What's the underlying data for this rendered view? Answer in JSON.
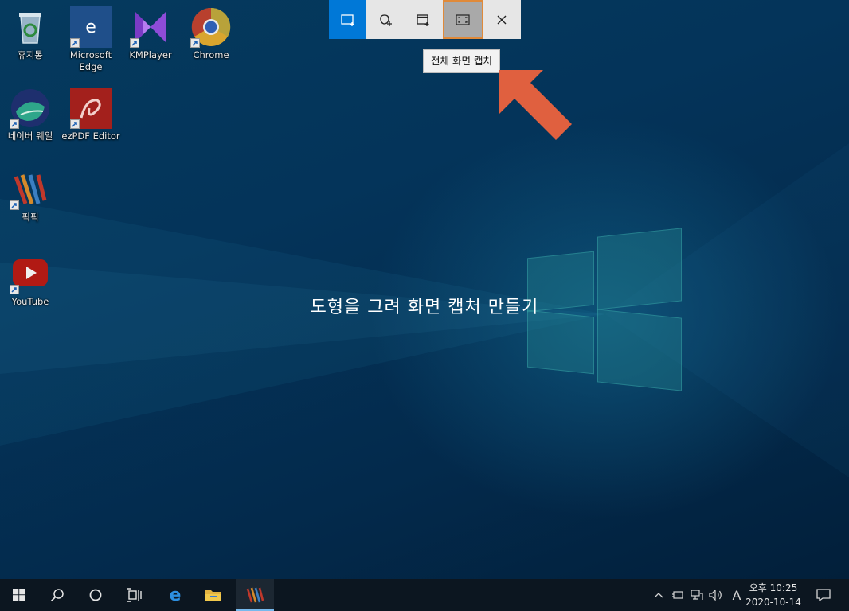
{
  "desktop": {
    "icons": [
      {
        "label": "휴지통",
        "icon": "recycle-bin-icon"
      },
      {
        "label": "Microsoft Edge",
        "icon": "edge-icon"
      },
      {
        "label": "KMPlayer",
        "icon": "kmplayer-icon"
      },
      {
        "label": "Chrome",
        "icon": "chrome-icon"
      },
      {
        "label": "네이버 웨일",
        "icon": "whale-icon"
      },
      {
        "label": "ezPDF Editor",
        "icon": "ezpdf-icon"
      },
      {
        "label": "픽픽",
        "icon": "picpick-icon"
      },
      {
        "label": "YouTube",
        "icon": "youtube-icon"
      }
    ],
    "overlay_hint": "도형을 그려 화면 캡처 만들기"
  },
  "snip_toolbar": {
    "buttons": [
      {
        "name": "rectangular-snip",
        "active": true
      },
      {
        "name": "freeform-snip",
        "active": false
      },
      {
        "name": "window-snip",
        "active": false
      },
      {
        "name": "fullscreen-snip",
        "hovered": true
      },
      {
        "name": "close",
        "active": false
      }
    ],
    "tooltip": "전체 화면 캡처",
    "accent": "#0078d7",
    "hover_border": "#e08a3a"
  },
  "annotation": {
    "arrow_color": "#e0603f"
  },
  "taskbar": {
    "pinned": [
      "windows-logo-icon",
      "search-icon",
      "cortana-icon",
      "task-view-icon",
      "edge-icon",
      "file-explorer-icon",
      "picpick-icon"
    ],
    "tray": {
      "ime": "A",
      "ampm_time": "오후 10:25",
      "date": "2020-10-14"
    }
  }
}
